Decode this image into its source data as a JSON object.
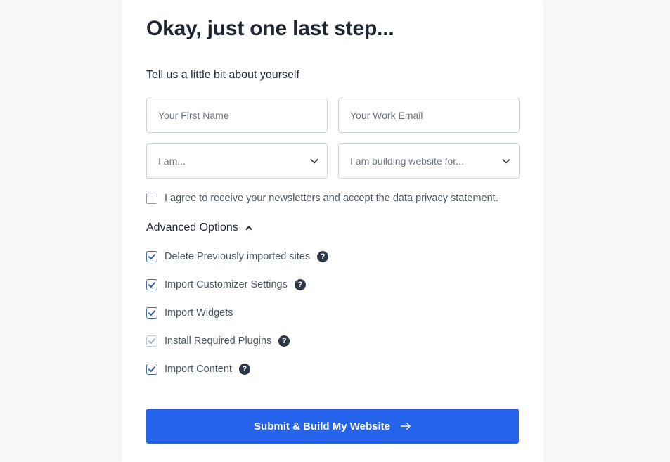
{
  "page": {
    "title": "Okay, just one last step...",
    "subtitle": "Tell us a little bit about yourself"
  },
  "form": {
    "first_name_placeholder": "Your First Name",
    "work_email_placeholder": "Your Work Email",
    "role_select_value": "I am...",
    "building_for_select_value": "I am building website for...",
    "newsletter_agreement": {
      "label": "I agree to receive your newsletters and accept the data privacy statement.",
      "checked": false
    }
  },
  "advanced_options": {
    "label": "Advanced Options",
    "expanded": true,
    "items": [
      {
        "label": "Delete Previously imported sites",
        "checked": true,
        "help": true
      },
      {
        "label": "Import Customizer Settings",
        "checked": true,
        "help": true
      },
      {
        "label": "Import Widgets",
        "checked": true,
        "help": false
      },
      {
        "label": "Install Required Plugins",
        "checked": true,
        "disabled": true,
        "help": true
      },
      {
        "label": "Import Content",
        "checked": true,
        "help": true
      }
    ],
    "help_glyph": "?"
  },
  "submit": {
    "label": "Submit & Build My Website"
  },
  "colors": {
    "accent": "#2563eb",
    "checkbox_check": "#2c5bbf",
    "checkbox_check_disabled": "#9cb3d9",
    "help_badge": "#2d3748"
  },
  "icons": {
    "select_arrow": "chevron-down-icon",
    "advanced_toggle": "chevron-up-icon",
    "help": "question-circle-icon",
    "submit_arrow": "arrow-right-icon"
  }
}
